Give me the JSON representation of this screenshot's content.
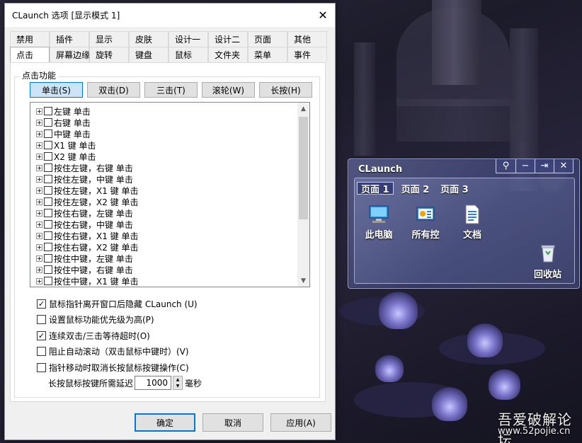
{
  "dialog": {
    "title": "CLaunch 选项 [显示模式 1]",
    "close_glyph": "✕",
    "tabs_row1": [
      "禁用",
      "插件",
      "显示",
      "皮肤",
      "设计一",
      "设计二",
      "页面",
      "其他"
    ],
    "tabs_row2": [
      "点击",
      "屏幕边缘",
      "旋转",
      "键盘",
      "鼠标",
      "文件夹",
      "菜单",
      "事件"
    ],
    "active_tab": "点击",
    "group_label": "点击功能",
    "click_buttons": [
      "单击(S)",
      "双击(D)",
      "三击(T)",
      "滚轮(W)",
      "长按(H)"
    ],
    "active_click_button": "单击(S)",
    "tree_items": [
      "左键 单击",
      "右键 单击",
      "中键 单击",
      "X1 键 单击",
      "X2 键 单击",
      "按住左键，右键 单击",
      "按住左键，中键 单击",
      "按住左键，X1 键 单击",
      "按住左键，X2 键 单击",
      "按住右键，左键 单击",
      "按住右键，中键 单击",
      "按住右键，X1 键 单击",
      "按住右键，X2 键 单击",
      "按住中键，左键 单击",
      "按住中键，右键 单击",
      "按住中键，X1 键 单击"
    ],
    "options": [
      {
        "label": "鼠标指针离开窗口后隐藏 CLaunch (U)",
        "checked": true
      },
      {
        "label": "设置鼠标功能优先级为高(P)",
        "checked": false
      },
      {
        "label": "连续双击/三击等待超时(O)",
        "checked": true
      },
      {
        "label": "阻止自动滚动（双击鼠标中键时）(V)",
        "checked": false
      },
      {
        "label": "指针移动时取消长按鼠标按键操作(C)",
        "checked": false
      }
    ],
    "delay": {
      "label": "长按鼠标按键所需延迟",
      "value": "1000",
      "unit": "毫秒"
    },
    "buttons": {
      "ok": "确定",
      "cancel": "取消",
      "apply": "应用(A)"
    }
  },
  "claunch": {
    "title": "CLaunch",
    "pages": [
      "页面 1",
      "页面 2",
      "页面 3"
    ],
    "active_page": "页面 1",
    "icons": [
      {
        "label": "此电脑",
        "icon": "computer-icon"
      },
      {
        "label": "所有控",
        "icon": "control-panel-icon"
      },
      {
        "label": "文档",
        "icon": "document-icon"
      }
    ],
    "recycle_label": "回收站"
  },
  "watermark": {
    "title": "吾爱破解论坛",
    "url": "www.52pojie.cn"
  }
}
